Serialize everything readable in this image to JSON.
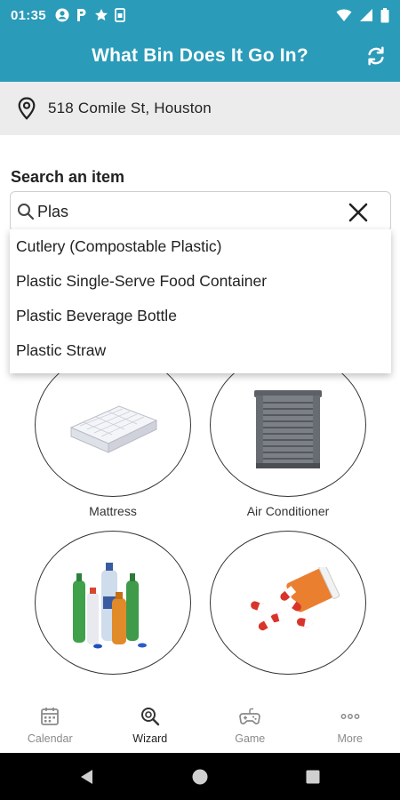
{
  "status_bar": {
    "time": "01:35"
  },
  "app_bar": {
    "title": "What Bin Does It Go In?"
  },
  "location": {
    "address": "518 Comile St, Houston"
  },
  "search": {
    "label": "Search an item",
    "value": "Plas",
    "suggestions": [
      "Cutlery (Compostable Plastic)",
      "Plastic Single-Serve Food Container",
      "Plastic Beverage Bottle",
      "Plastic Straw"
    ]
  },
  "items": [
    {
      "label": "Mattress",
      "icon": "mattress-image"
    },
    {
      "label": "Air Conditioner",
      "icon": "air-conditioner-image"
    },
    {
      "label": "",
      "icon": "plastic-bottles-image"
    },
    {
      "label": "",
      "icon": "pills-image"
    }
  ],
  "bottom_nav": {
    "items": [
      {
        "label": "Calendar",
        "icon": "calendar-icon",
        "active": false
      },
      {
        "label": "Wizard",
        "icon": "wizard-search-icon",
        "active": true
      },
      {
        "label": "Game",
        "icon": "game-icon",
        "active": false
      },
      {
        "label": "More",
        "icon": "more-icon",
        "active": false
      }
    ]
  },
  "colors": {
    "accent": "#2a9bb8",
    "address_bg": "#ececec"
  }
}
